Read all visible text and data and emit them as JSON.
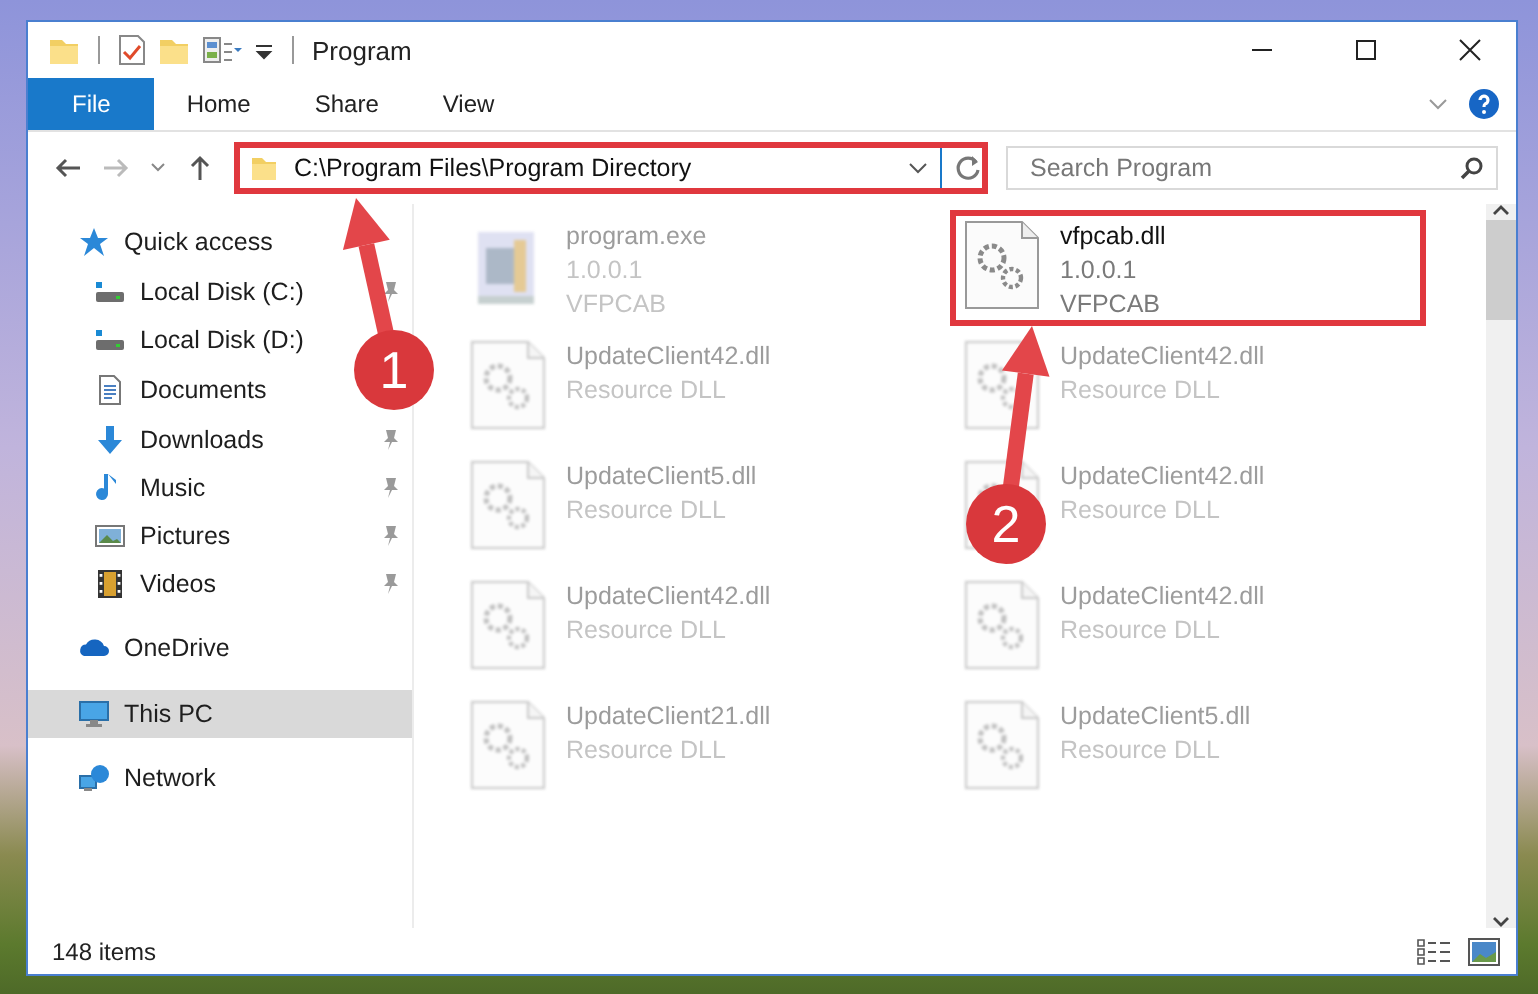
{
  "window": {
    "title": "Program"
  },
  "ribbon_tabs": [
    {
      "label": "File",
      "kind": "file"
    },
    {
      "label": "Home",
      "kind": "tab"
    },
    {
      "label": "Share",
      "kind": "tab"
    },
    {
      "label": "View",
      "kind": "tab"
    }
  ],
  "address_bar": {
    "path": "C:\\Program Files\\Program Directory",
    "highlighted": true
  },
  "search": {
    "placeholder": "Search Program"
  },
  "sidebar": {
    "items": [
      {
        "label": "Quick access",
        "kind": "star",
        "selected": false,
        "children": [
          {
            "label": "Local Disk (C:)",
            "kind": "drive",
            "pinned": true,
            "selected": false
          },
          {
            "label": "Local Disk (D:)",
            "kind": "drive",
            "pinned": false,
            "selected": false
          },
          {
            "label": "Documents",
            "kind": "document",
            "pinned": false,
            "selected": false
          },
          {
            "label": "Downloads",
            "kind": "download",
            "pinned": true,
            "selected": false
          },
          {
            "label": "Music",
            "kind": "music",
            "pinned": true,
            "selected": false
          },
          {
            "label": "Pictures",
            "kind": "pictures",
            "pinned": true,
            "selected": false
          },
          {
            "label": "Videos",
            "kind": "video",
            "pinned": true,
            "selected": false
          }
        ]
      },
      {
        "label": "OneDrive",
        "kind": "cloud",
        "selected": false
      },
      {
        "label": "This PC",
        "kind": "computer",
        "selected": true
      },
      {
        "label": "Network",
        "kind": "network",
        "selected": false
      }
    ]
  },
  "files": [
    {
      "name": "program.exe",
      "details": [
        "1.0.0.1",
        "VFPCAB"
      ],
      "kind": "exe",
      "blurred": true,
      "highlighted": false
    },
    {
      "name": "vfpcab.dll",
      "details": [
        "1.0.0.1",
        "VFPCAB"
      ],
      "kind": "dll",
      "blurred": false,
      "highlighted": true
    },
    {
      "name": "UpdateClient42.dll",
      "details": [
        "Resource DLL"
      ],
      "kind": "dll",
      "blurred": true,
      "highlighted": false
    },
    {
      "name": "UpdateClient42.dll",
      "details": [
        "Resource DLL"
      ],
      "kind": "dll",
      "blurred": true,
      "highlighted": false
    },
    {
      "name": "UpdateClient5.dll",
      "details": [
        "Resource DLL"
      ],
      "kind": "dll",
      "blurred": true,
      "highlighted": false
    },
    {
      "name": "UpdateClient42.dll",
      "details": [
        "Resource DLL"
      ],
      "kind": "dll",
      "blurred": true,
      "highlighted": false
    },
    {
      "name": "UpdateClient42.dll",
      "details": [
        "Resource DLL"
      ],
      "kind": "dll",
      "blurred": true,
      "highlighted": false
    },
    {
      "name": "UpdateClient42.dll",
      "details": [
        "Resource DLL"
      ],
      "kind": "dll",
      "blurred": true,
      "highlighted": false
    },
    {
      "name": "UpdateClient21.dll",
      "details": [
        "Resource DLL"
      ],
      "kind": "dll",
      "blurred": true,
      "highlighted": false
    },
    {
      "name": "UpdateClient5.dll",
      "details": [
        "Resource DLL"
      ],
      "kind": "dll",
      "blurred": true,
      "highlighted": false
    }
  ],
  "annotations": [
    {
      "label": "1"
    },
    {
      "label": "2"
    }
  ],
  "status_bar": {
    "count": "148 items"
  }
}
